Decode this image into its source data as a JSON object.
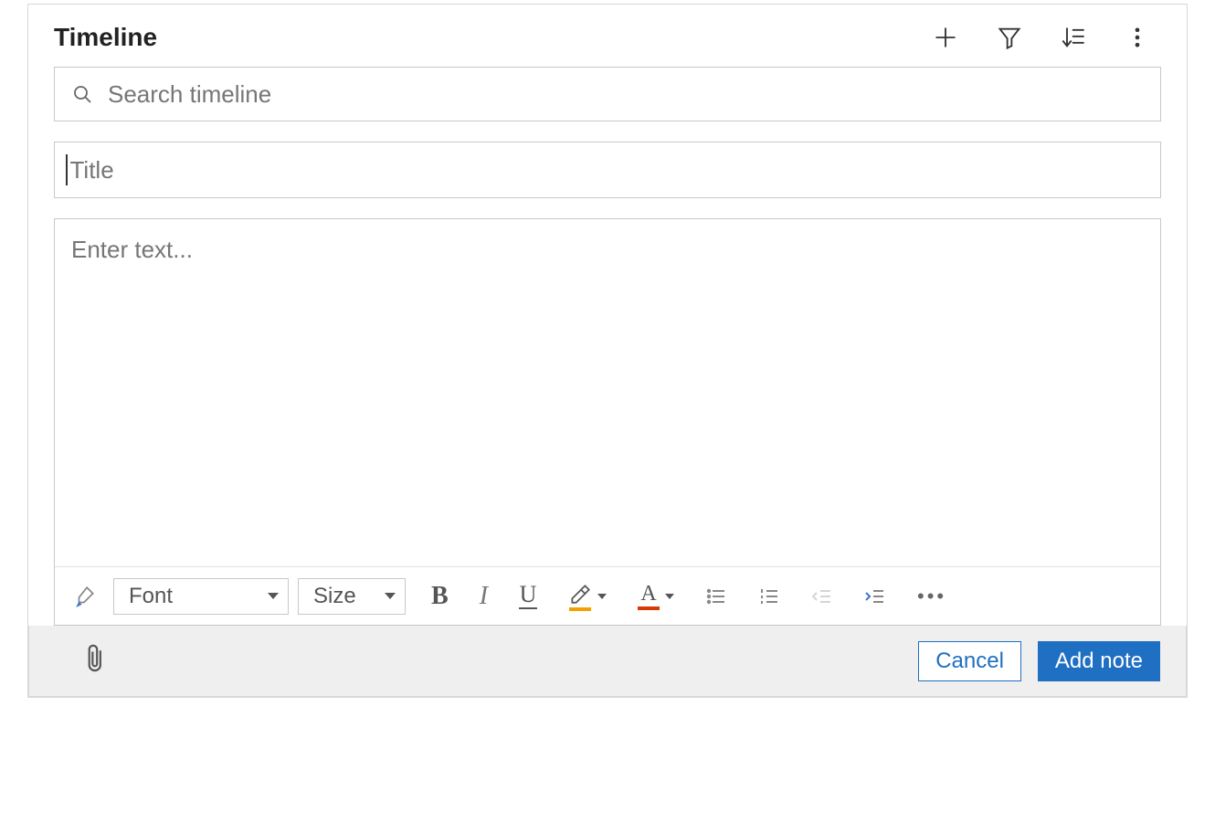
{
  "header": {
    "title": "Timeline"
  },
  "search": {
    "placeholder": "Search timeline",
    "value": ""
  },
  "note": {
    "title_placeholder": "Title",
    "title_value": "",
    "body_placeholder": "Enter text...",
    "body_value": ""
  },
  "toolbar": {
    "font_label": "Font",
    "size_label": "Size"
  },
  "footer": {
    "cancel_label": "Cancel",
    "submit_label": "Add note"
  }
}
